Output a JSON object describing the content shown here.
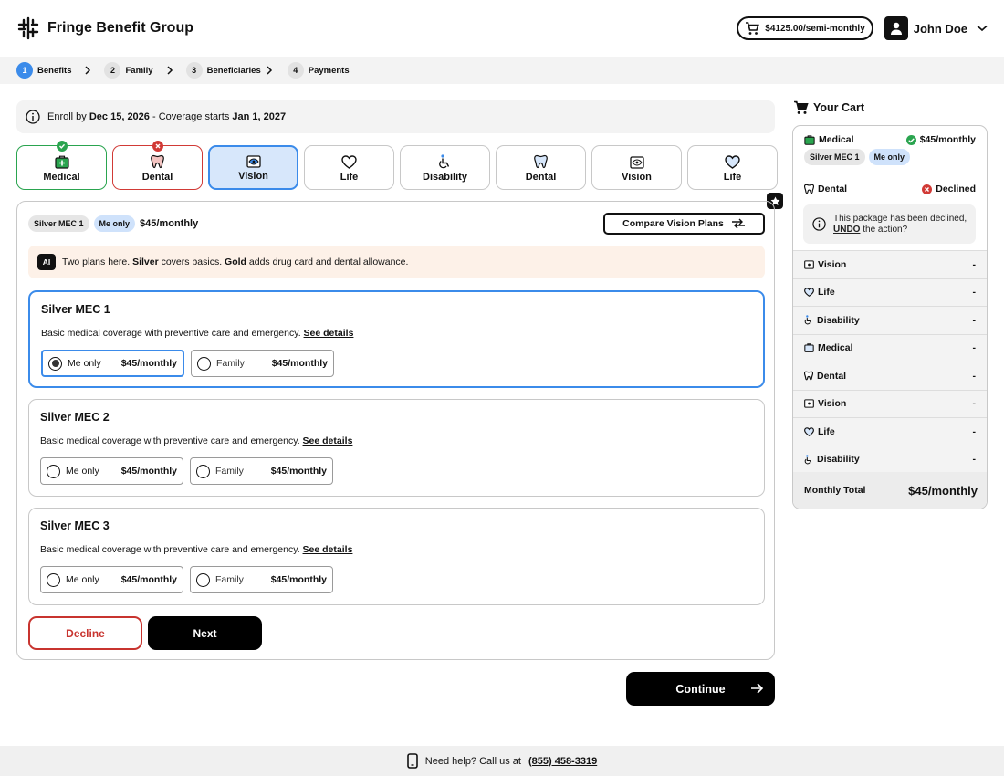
{
  "header": {
    "brand": "Fringe Benefit Group",
    "cart_total": "$4125.00/semi-monthly",
    "user_name": "John Doe"
  },
  "steps": [
    {
      "num": "1",
      "label": "Benefits",
      "active": true
    },
    {
      "num": "2",
      "label": "Family"
    },
    {
      "num": "3",
      "label": "Beneficiaries"
    },
    {
      "num": "4",
      "label": "Payments"
    }
  ],
  "notice": {
    "prefix": "Enroll by",
    "deadline": "Dec 15, 2026",
    "middle": "- Coverage starts",
    "start": "Jan 1, 2027"
  },
  "tabs": [
    {
      "label": "Medical",
      "icon": "medical-kit-icon",
      "status": "ok"
    },
    {
      "label": "Dental",
      "icon": "tooth-icon",
      "status": "declined"
    },
    {
      "label": "Vision",
      "icon": "eye-icon",
      "status": "active"
    },
    {
      "label": "Life",
      "icon": "heart-icon"
    },
    {
      "label": "Disability",
      "icon": "accessibility-icon"
    },
    {
      "label": "Dental",
      "icon": "tooth-icon"
    },
    {
      "label": "Vision",
      "icon": "eye-icon"
    },
    {
      "label": "Life",
      "icon": "heart-icon"
    }
  ],
  "panel": {
    "chip_plan": "Silver MEC 1",
    "chip_tier": "Me only",
    "price": "$45/monthly",
    "compare_label": "Compare Vision Plans",
    "ai_badge": "AI",
    "ai_text_1": "Two plans here.",
    "ai_bold_1": "Silver",
    "ai_text_2": "covers basics.",
    "ai_bold_2": "Gold",
    "ai_text_3": "adds drug card and dental allowance."
  },
  "plans": [
    {
      "title": "Silver MEC 1",
      "desc": "Basic medical coverage with preventive care and emergency.",
      "link": "See details",
      "opt1_label": "Me only",
      "opt1_price": "$45/monthly",
      "opt2_label": "Family",
      "opt2_price": "$45/monthly"
    },
    {
      "title": "Silver MEC 2",
      "desc": "Basic medical coverage with preventive care and emergency.",
      "link": "See details",
      "opt1_label": "Me only",
      "opt1_price": "$45/monthly",
      "opt2_label": "Family",
      "opt2_price": "$45/monthly"
    },
    {
      "title": "Silver MEC 3",
      "desc": "Basic medical coverage with preventive care and emergency.",
      "link": "See details",
      "opt1_label": "Me only",
      "opt1_price": "$45/monthly",
      "opt2_label": "Family",
      "opt2_price": "$45/monthly"
    }
  ],
  "actions": {
    "decline": "Decline",
    "next": "Next",
    "continue": "Continue"
  },
  "cart": {
    "title": "Your Cart",
    "medical_label": "Medical",
    "medical_amount": "$45/monthly",
    "medical_chip_plan": "Silver MEC 1",
    "medical_chip_tier": "Me only",
    "dental_label": "Dental",
    "dental_status": "Declined",
    "decline_msg_1": "This package has been declined,",
    "decline_undo": "UNDO",
    "decline_msg_2": "the action?",
    "rows": [
      {
        "label": "Vision",
        "value": "-"
      },
      {
        "label": "Life",
        "value": "-"
      },
      {
        "label": "Disability",
        "value": "-"
      },
      {
        "label": "Medical",
        "value": "-"
      },
      {
        "label": "Dental",
        "value": "-"
      },
      {
        "label": "Vision",
        "value": "-"
      },
      {
        "label": "Life",
        "value": "-"
      },
      {
        "label": "Disability",
        "value": "-"
      }
    ],
    "total_label": "Monthly Total",
    "total_value": "$45/monthly"
  },
  "footer": {
    "text": "Need help? Call us at",
    "phone": "(855) 458-3319"
  },
  "colors": {
    "accent": "#3b8bea",
    "success": "#2aa44f",
    "danger": "#d13a36"
  }
}
